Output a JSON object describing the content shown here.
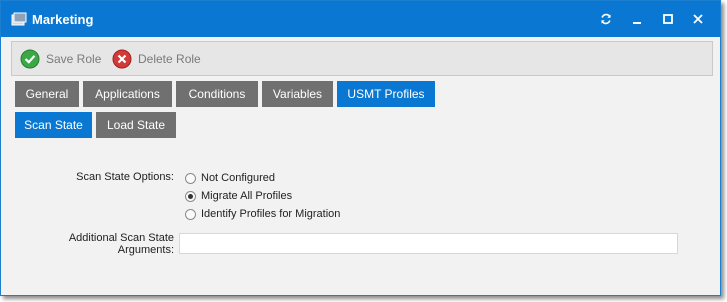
{
  "window": {
    "title": "Marketing"
  },
  "titlebar_buttons": {
    "refresh": "refresh-icon",
    "minimize": "minimize-icon",
    "maximize": "maximize-icon",
    "close": "close-icon"
  },
  "toolbar": {
    "save_label": "Save Role",
    "delete_label": "Delete Role"
  },
  "tabs": [
    {
      "label": "General"
    },
    {
      "label": "Applications"
    },
    {
      "label": "Conditions"
    },
    {
      "label": "Variables"
    },
    {
      "label": "USMT Profiles",
      "active": true
    }
  ],
  "subtabs": [
    {
      "label": "Scan State",
      "active": true
    },
    {
      "label": "Load State"
    }
  ],
  "form": {
    "scan_state_options_label": "Scan State Options:",
    "options": [
      {
        "label": "Not Configured",
        "selected": false
      },
      {
        "label": "Migrate All Profiles",
        "selected": true
      },
      {
        "label": "Identify Profiles for Migration",
        "selected": false
      }
    ],
    "additional_label_line1": "Additional Scan State",
    "additional_label_line2": "Arguments:",
    "additional_value": ""
  },
  "colors": {
    "accent": "#0a78d2",
    "tab_inactive": "#707070",
    "save_green": "#3aa845",
    "delete_red": "#d23a3a"
  }
}
